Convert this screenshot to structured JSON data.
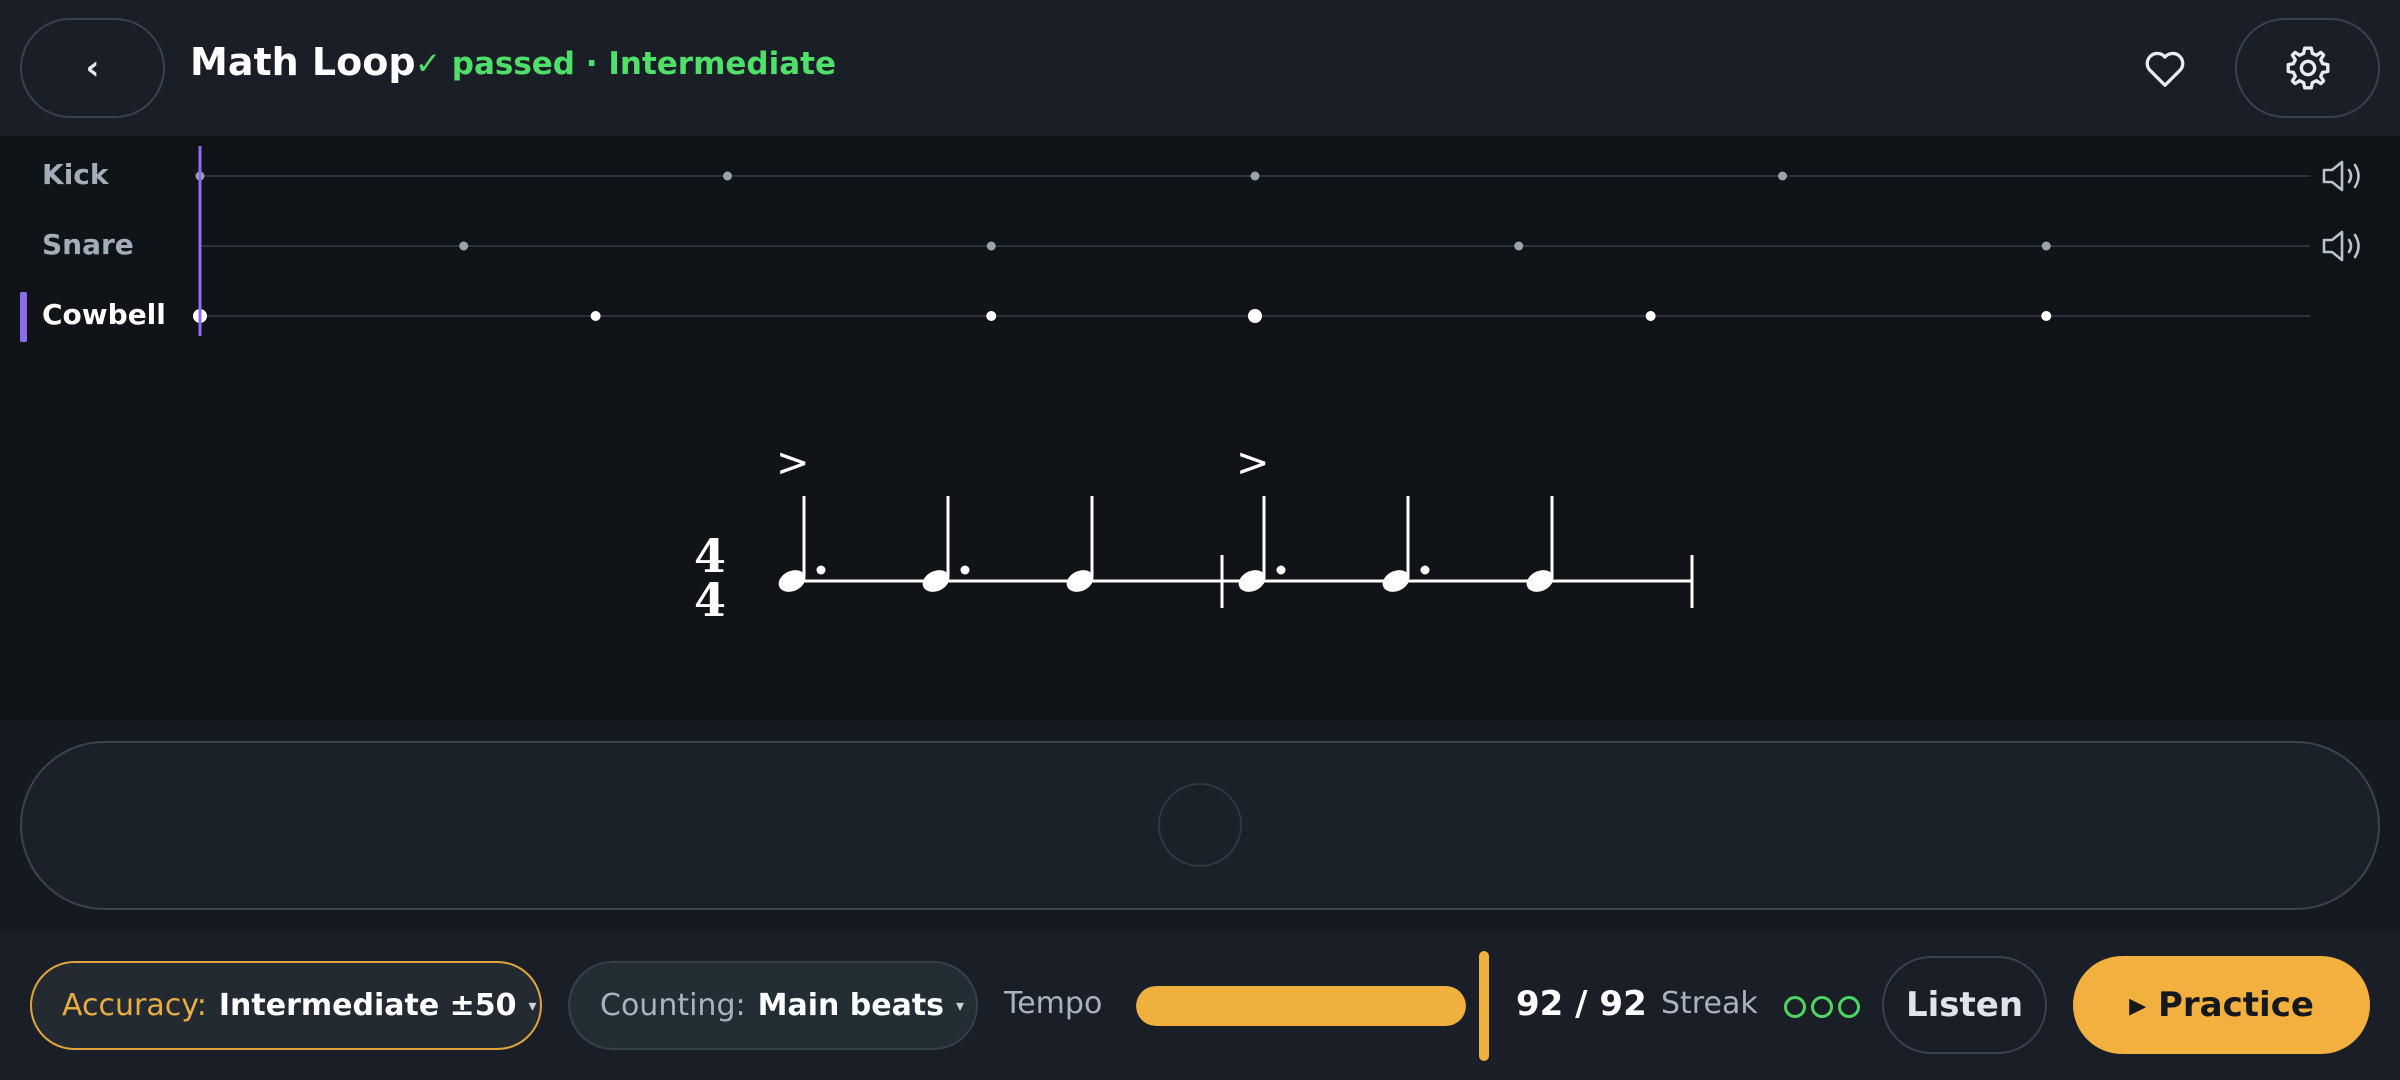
{
  "header": {
    "back_label": "‹",
    "title": "Math Loop",
    "status": "✓ passed · Intermediate"
  },
  "tracks": [
    {
      "name": "Kick",
      "active": false,
      "hits": [
        0,
        0.25,
        0.5,
        0.75
      ],
      "accents": []
    },
    {
      "name": "Snare",
      "active": false,
      "hits": [
        0.125,
        0.375,
        0.625,
        0.875
      ],
      "accents": []
    },
    {
      "name": "Cowbell",
      "active": true,
      "hits": [
        0,
        0.1875,
        0.375,
        0.5,
        0.6875,
        0.875
      ],
      "accents": [
        0,
        0.5
      ]
    }
  ],
  "notation": {
    "time_signature_top": "4",
    "time_signature_bottom": "4",
    "accent_symbol": ">"
  },
  "footer": {
    "accuracy_label": "Accuracy:",
    "accuracy_value": "Intermediate ±50",
    "counting_label": "Counting:",
    "counting_value": "Main beats",
    "caret": "▾",
    "tempo_label": "Tempo",
    "tempo_fill_fraction": 1.0,
    "tempo_value": "92 / 92",
    "streak_label": "Streak",
    "streak_count": 3,
    "listen_label": "Listen",
    "practice_label": "▸ Practice"
  },
  "colors": {
    "accent_purple": "#8b6ef0",
    "accent_orange": "#f2b13f",
    "success_green": "#4fe06a"
  }
}
